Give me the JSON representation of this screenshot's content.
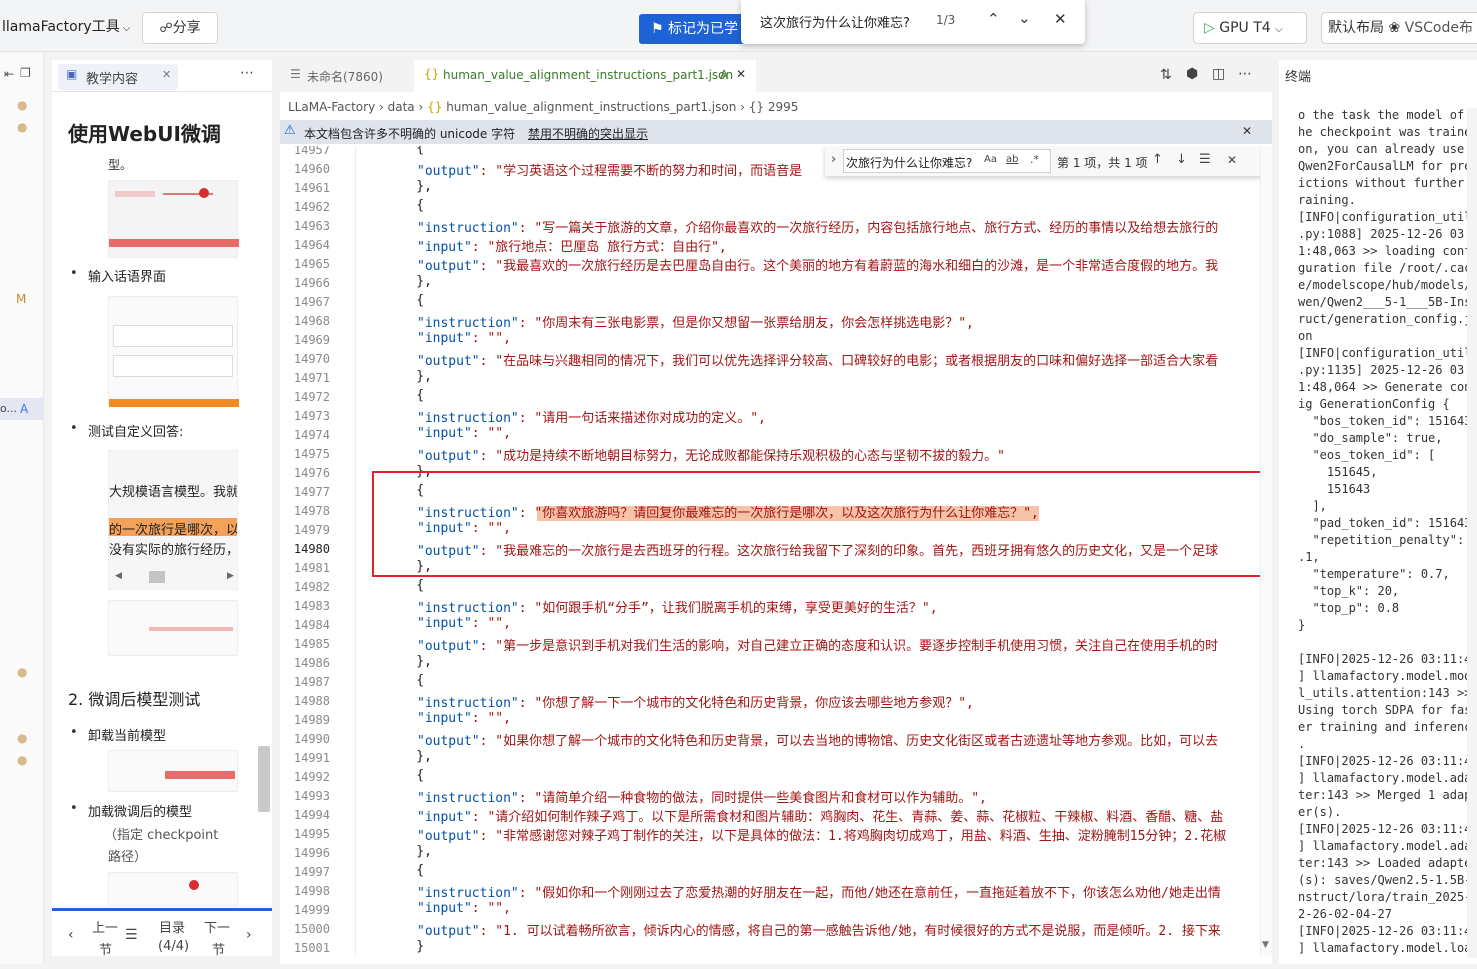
{
  "topbar": {
    "project": "llamaFactory工具",
    "share": "分享",
    "mark_done": "标记为已学",
    "gpu": "GPU T4",
    "layout": "默认布局",
    "vscode": "VSCode布"
  },
  "find_top": {
    "query": "这次旅行为什么让你难忘?",
    "count": "1/3"
  },
  "rail": {
    "m_label": "M",
    "a_label": "A",
    "item_label": "o..."
  },
  "doc_panel": {
    "tab": "教学内容",
    "title": "使用WebUI微调",
    "title_tail": "型。",
    "bullets": [
      "输入话语界面",
      "测试自定义回答:",
      "卸载当前模型",
      "加载微调后的模型"
    ],
    "crop_texts": [
      "大规模语言模型。我就",
      "的一次旅行是哪次，以",
      "没有实际的旅行经历，"
    ],
    "section": "2. 微调后模型测试",
    "bullet_sub": [
      "（指定 checkpoint",
      "路径）"
    ],
    "nav": {
      "prev": "上一",
      "prev2": "节",
      "toc": "目录",
      "toc_count": "(4/4)",
      "next": "下一",
      "next2": "节"
    }
  },
  "editor": {
    "tab_inactive": "未命名(7860)",
    "tab_active": "human_value_alignment_instructions_part1.json",
    "tab_badge": "A",
    "breadcrumb": [
      "LLaMA-Factory",
      "data",
      "human_value_alignment_instructions_part1.json",
      "{} 2995"
    ],
    "unicode_warning": "本文档包含许多不明确的 unicode 字符",
    "unicode_link": "禁用不明确的突出显示",
    "find": {
      "query": "次旅行为什么让你难忘?",
      "result": "第 1 项，共 1 项"
    },
    "lines": [
      {
        "n": "14957",
        "k": "",
        "t": "    {"
      },
      {
        "n": "14960",
        "k": "\"output\"",
        "t": ": \"学习英语这个过程需要不断的努力和时间，而语音是"
      },
      {
        "n": "14961",
        "k": "",
        "t": "    },"
      },
      {
        "n": "14962",
        "k": "",
        "t": "    {"
      },
      {
        "n": "14963",
        "k": "\"instruction\"",
        "t": ": \"写一篇关于旅游的文章，介绍你最喜欢的一次旅行经历，内容包括旅行地点、旅行方式、经历的事情以及给想去旅行的"
      },
      {
        "n": "14964",
        "k": "\"input\"",
        "t": ": \"旅行地点：巴厘岛 旅行方式：自由行\","
      },
      {
        "n": "14965",
        "k": "\"output\"",
        "t": ": \"我最喜欢的一次旅行经历是去巴厘岛自由行。这个美丽的地方有着蔚蓝的海水和细白的沙滩，是一个非常适合度假的地方。我"
      },
      {
        "n": "14966",
        "k": "",
        "t": "    },"
      },
      {
        "n": "14967",
        "k": "",
        "t": "    {"
      },
      {
        "n": "14968",
        "k": "\"instruction\"",
        "t": ": \"你周末有三张电影票，但是你又想留一张票给朋友，你会怎样挑选电影？\","
      },
      {
        "n": "14969",
        "k": "\"input\"",
        "t": ": \"\","
      },
      {
        "n": "14970",
        "k": "\"output\"",
        "t": ": \"在品味与兴趣相同的情况下，我们可以优先选择评分较高、口碑较好的电影；或者根据朋友的口味和偏好选择一部适合大家看"
      },
      {
        "n": "14971",
        "k": "",
        "t": "    },"
      },
      {
        "n": "14972",
        "k": "",
        "t": "    {"
      },
      {
        "n": "14973",
        "k": "\"instruction\"",
        "t": ": \"请用一句话来描述你对成功的定义。\","
      },
      {
        "n": "14974",
        "k": "\"input\"",
        "t": ": \"\","
      },
      {
        "n": "14975",
        "k": "\"output\"",
        "t": ": \"成功是持续不断地朝目标努力，无论成败都能保持乐观积极的心态与坚韧不拔的毅力。\""
      },
      {
        "n": "14976",
        "k": "",
        "t": "    },"
      },
      {
        "n": "14977",
        "k": "",
        "t": "    {"
      },
      {
        "n": "14978",
        "k": "\"instruction\"",
        "t": ": \"你喜欢旅游吗？请回复你最难忘的一次旅行是哪次，以及这次旅行为什么让你难忘？\","
      },
      {
        "n": "14979",
        "k": "\"input\"",
        "t": ": \"\","
      },
      {
        "n": "14980",
        "k": "\"output\"",
        "t": ": \"我最难忘的一次旅行是去西班牙的行程。这次旅行给我留下了深刻的印象。首先，西班牙拥有悠久的历史文化，又是一个足球"
      },
      {
        "n": "14981",
        "k": "",
        "t": "    },"
      },
      {
        "n": "14982",
        "k": "",
        "t": "    {"
      },
      {
        "n": "14983",
        "k": "\"instruction\"",
        "t": ": \"如何跟手机“分手”，让我们脱离手机的束缚，享受更美好的生活？\","
      },
      {
        "n": "14984",
        "k": "\"input\"",
        "t": ": \"\","
      },
      {
        "n": "14985",
        "k": "\"output\"",
        "t": ": \"第一步是意识到手机对我们生活的影响，对自己建立正确的态度和认识。要逐步控制手机使用习惯，关注自己在使用手机的时"
      },
      {
        "n": "14986",
        "k": "",
        "t": "    },"
      },
      {
        "n": "14987",
        "k": "",
        "t": "    {"
      },
      {
        "n": "14988",
        "k": "\"instruction\"",
        "t": ": \"你想了解一下一个城市的文化特色和历史背景，你应该去哪些地方参观？\","
      },
      {
        "n": "14989",
        "k": "\"input\"",
        "t": ": \"\","
      },
      {
        "n": "14990",
        "k": "\"output\"",
        "t": ": \"如果你想了解一个城市的文化特色和历史背景，可以去当地的博物馆、历史文化街区或者古迹遗址等地方参观。比如，可以去"
      },
      {
        "n": "14991",
        "k": "",
        "t": "    },"
      },
      {
        "n": "14992",
        "k": "",
        "t": "    {"
      },
      {
        "n": "14993",
        "k": "\"instruction\"",
        "t": ": \"请简单介绍一种食物的做法，同时提供一些美食图片和食材可以作为辅助。\","
      },
      {
        "n": "14994",
        "k": "\"input\"",
        "t": ": \"请介绍如何制作辣子鸡丁。以下是所需食材和图片辅助：鸡胸肉、花生、青蒜、姜、蒜、花椒粒、干辣椒、料酒、香醋、糖、盐"
      },
      {
        "n": "14995",
        "k": "\"output\"",
        "t": ": \"非常感谢您对辣子鸡丁制作的关注，以下是具体的做法：1.将鸡胸肉切成鸡丁，用盐、料酒、生抽、淀粉腌制15分钟；2.花椒"
      },
      {
        "n": "14996",
        "k": "",
        "t": "    },"
      },
      {
        "n": "14997",
        "k": "",
        "t": "    {"
      },
      {
        "n": "14998",
        "k": "\"instruction\"",
        "t": ": \"假如你和一个刚刚过去了恋爱热潮的好朋友在一起，而他/她还在意前任，一直拖延着放不下，你该怎么劝他/她走出情"
      },
      {
        "n": "14999",
        "k": "\"input\"",
        "t": ": \"\","
      },
      {
        "n": "15000",
        "k": "\"output\"",
        "t": ": \"1. 可以试着畅所欲言，倾诉内心的情感，将自己的第一感触告诉他/她，有时候很好的方式不是说服，而是倾听。2. 接下来"
      },
      {
        "n": "15001",
        "k": "",
        "t": "    }"
      }
    ]
  },
  "terminal": {
    "title": "终端",
    "lines": [
      "o the task the model of t",
      "he checkpoint was trained",
      "on, you can already use",
      "Qwen2ForCausalLM for pred",
      "ictions without further t",
      "raining.",
      "[INFO|configuration_utils",
      ".py:1088] 2025-12-26 03:1",
      "1:48,063 >> loading confi",
      "guration file /root/.cach",
      "e/modelscope/hub/models/Q",
      "wen/Qwen2___5-1___5B-Inst",
      "ruct/generation_config.js",
      "on",
      "[INFO|configuration_utils",
      ".py:1135] 2025-12-26 03:1",
      "1:48,064 >> Generate conf",
      "ig GenerationConfig {",
      "  \"bos_token_id\": 151643,",
      "  \"do_sample\": true,",
      "  \"eos_token_id\": [",
      "    151645,",
      "    151643",
      "  ],",
      "  \"pad_token_id\": 151643,",
      "  \"repetition_penalty\": 1",
      ".1,",
      "  \"temperature\": 0.7,",
      "  \"top_k\": 20,",
      "  \"top_p\": 0.8",
      "}",
      "",
      "[INFO|2025-12-26 03:11:48",
      "] llamafactory.model.mode",
      "l_utils.attention:143 >>",
      "Using torch SDPA for fast",
      "er training and inference",
      ".",
      "[INFO|2025-12-26 03:11:48",
      "] llamafactory.model.adap",
      "ter:143 >> Merged 1 adapt",
      "er(s).",
      "[INFO|2025-12-26 03:11:48",
      "] llamafactory.model.adap",
      "ter:143 >> Loaded adapter",
      "(s): saves/Qwen2.5-1.5B-I",
      "nstruct/lora/train_2025-1",
      "2-26-02-04-27",
      "[INFO|2025-12-26 03:11:48",
      "] llamafactory.model.load"
    ]
  }
}
